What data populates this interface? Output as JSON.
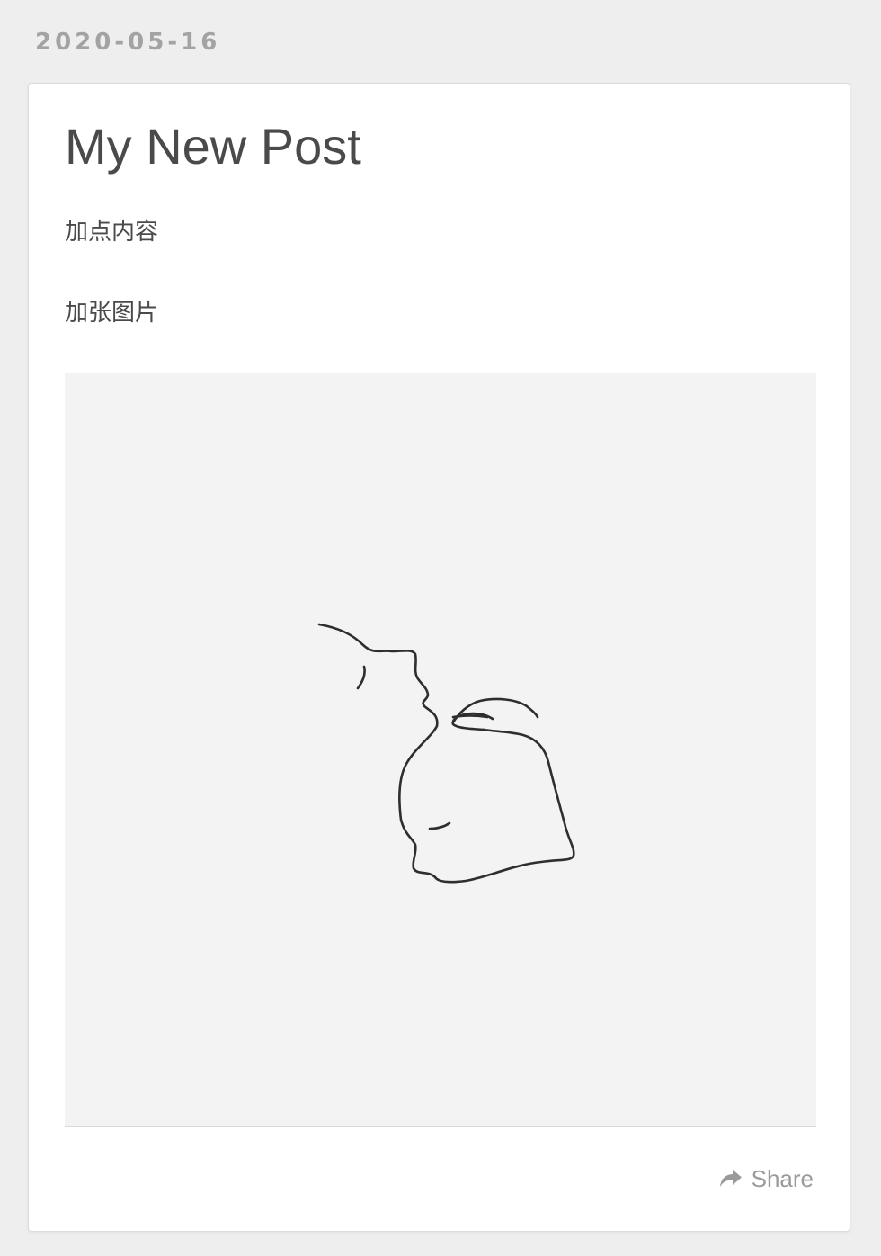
{
  "post": {
    "date": "2020-05-16",
    "title": "My New Post",
    "paragraphs": [
      "加点内容",
      "加张图片"
    ],
    "image_alt": "line drawing of two figures"
  },
  "footer": {
    "share_label": "Share",
    "share_icon": "share-arrow-icon"
  },
  "colors": {
    "page_background": "#eeeeee",
    "card_background": "#ffffff",
    "date_text": "#a3a3a3",
    "body_text": "#4a4a4a",
    "share_text": "#9a9a9a",
    "image_background": "#f4f3f4"
  }
}
